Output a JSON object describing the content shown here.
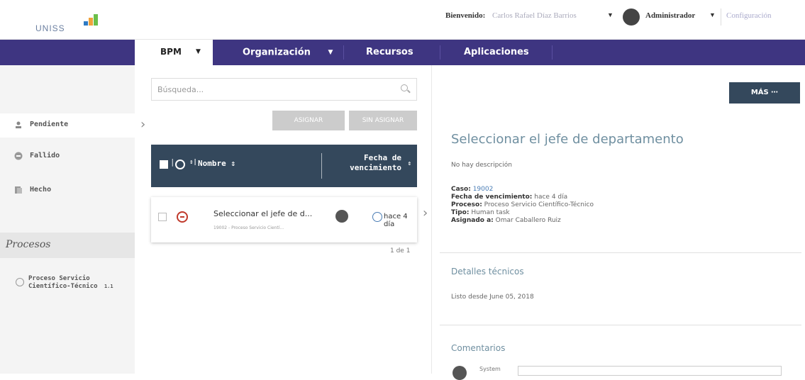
{
  "header": {
    "logo_text": "UNISS",
    "welcome_label": "Bienvenido:",
    "user_name": "Carlos Rafael Díaz Barrios",
    "role": "Administrador",
    "config": "Configuración"
  },
  "nav": {
    "items": [
      {
        "label": "BPM"
      },
      {
        "label": "Organización"
      },
      {
        "label": "Recursos"
      },
      {
        "label": "Aplicaciones"
      }
    ]
  },
  "sidebar": {
    "items": [
      {
        "label": "Pendiente"
      },
      {
        "label": "Fallido"
      },
      {
        "label": "Hecho"
      }
    ],
    "procesos_heading": "Procesos",
    "process": {
      "label": "Proceso Servicio Científico-Técnico",
      "version": "1.1"
    }
  },
  "list": {
    "search_placeholder": "Búsqueda...",
    "assign_label": "ASIGNAR",
    "unassign_label": "SIN ASIGNAR",
    "col_name": "Nombre ⇕",
    "col_due_line1": "Fecha de",
    "col_due_line2": "vencimiento",
    "row": {
      "title": "Seleccionar el jefe de d...",
      "subtitle": "19002 - Proceso Servicio Cientí...",
      "due": "hace 4 día"
    },
    "pager": "1 de 1"
  },
  "detail": {
    "more_label": "MÁS ⋯",
    "title": "Seleccionar el jefe de departamento",
    "description": "No hay descripción",
    "case_label": "Caso:",
    "case_value": "19002",
    "due_label": "Fecha de vencimiento:",
    "due_value": "hace 4 día",
    "process_label": "Proceso:",
    "process_value": "Proceso Servicio Científico-Técnico",
    "type_label": "Tipo:",
    "type_value": "Human task",
    "assigned_label": "Asignado a:",
    "assigned_value": "Omar Caballero Ruiz",
    "tech_heading": "Detalles técnicos",
    "ready_since": "Listo desde June 05, 2018",
    "comments_heading": "Comentarios",
    "comment_user": "System"
  },
  "colors": {
    "nav_bg": "#3e3581",
    "table_header": "#34485c",
    "accent_title": "#6f8fa0"
  }
}
